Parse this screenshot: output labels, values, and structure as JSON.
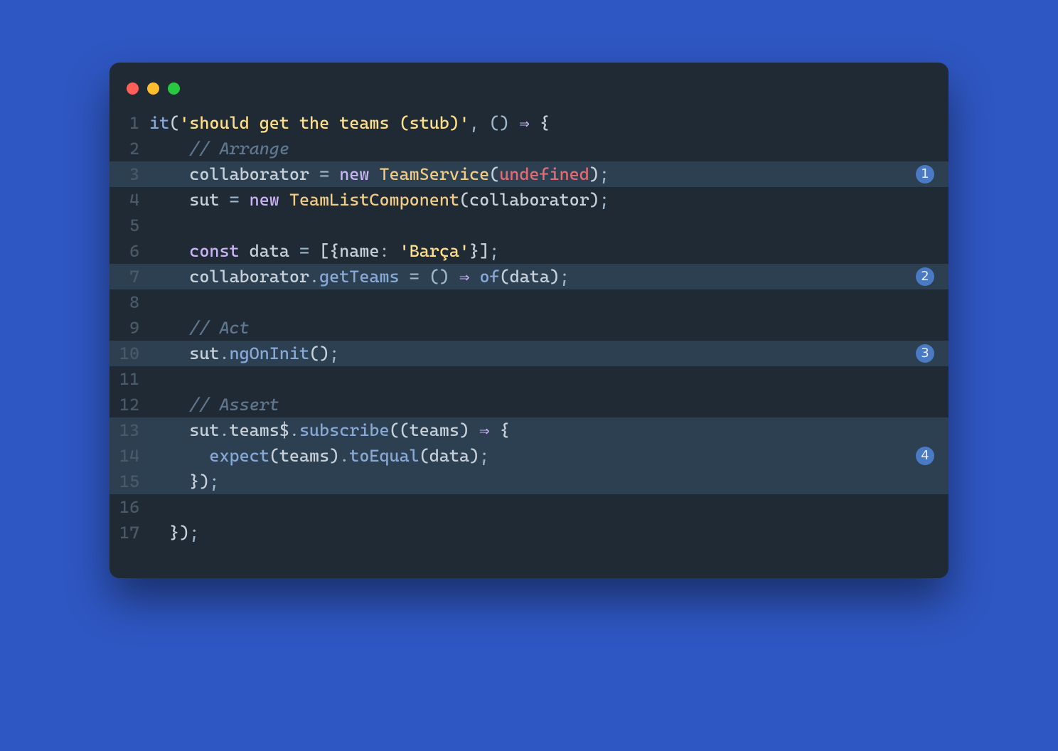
{
  "window": {
    "traffic_light": {
      "close": "close",
      "minimize": "minimize",
      "zoom": "zoom"
    }
  },
  "code": {
    "lines": [
      {
        "n": "1",
        "highlight": false,
        "badge": null,
        "tokens": [
          {
            "t": "it",
            "c": "tok-fn"
          },
          {
            "t": "(",
            "c": "tok-par"
          },
          {
            "t": "'should get the teams (stub)'",
            "c": "tok-str"
          },
          {
            "t": ", () ",
            "c": "tok-op"
          },
          {
            "t": "⇒",
            "c": "tok-arrow"
          },
          {
            "t": " {",
            "c": "tok-par"
          }
        ]
      },
      {
        "n": "2",
        "highlight": false,
        "badge": null,
        "tokens": [
          {
            "t": "    ",
            "c": "tok-op"
          },
          {
            "t": "// Arrange",
            "c": "tok-cmt"
          }
        ]
      },
      {
        "n": "3",
        "highlight": true,
        "badge": "1",
        "tokens": [
          {
            "t": "    ",
            "c": "tok-op"
          },
          {
            "t": "collaborator",
            "c": "tok-var"
          },
          {
            "t": " = ",
            "c": "tok-op"
          },
          {
            "t": "new ",
            "c": "tok-kw"
          },
          {
            "t": "TeamService",
            "c": "tok-type"
          },
          {
            "t": "(",
            "c": "tok-par"
          },
          {
            "t": "undefined",
            "c": "tok-const"
          },
          {
            "t": ")",
            "c": "tok-par"
          },
          {
            "t": ";",
            "c": "tok-op"
          }
        ]
      },
      {
        "n": "4",
        "highlight": false,
        "badge": null,
        "tokens": [
          {
            "t": "    ",
            "c": "tok-op"
          },
          {
            "t": "sut",
            "c": "tok-var"
          },
          {
            "t": " = ",
            "c": "tok-op"
          },
          {
            "t": "new ",
            "c": "tok-kw"
          },
          {
            "t": "TeamListComponent",
            "c": "tok-type"
          },
          {
            "t": "(",
            "c": "tok-par"
          },
          {
            "t": "collaborator",
            "c": "tok-var"
          },
          {
            "t": ")",
            "c": "tok-par"
          },
          {
            "t": ";",
            "c": "tok-op"
          }
        ]
      },
      {
        "n": "5",
        "highlight": false,
        "badge": null,
        "tokens": []
      },
      {
        "n": "6",
        "highlight": false,
        "badge": null,
        "tokens": [
          {
            "t": "    ",
            "c": "tok-op"
          },
          {
            "t": "const ",
            "c": "tok-kw"
          },
          {
            "t": "data",
            "c": "tok-var"
          },
          {
            "t": " = ",
            "c": "tok-op"
          },
          {
            "t": "[{",
            "c": "tok-par"
          },
          {
            "t": "name",
            "c": "tok-var"
          },
          {
            "t": ": ",
            "c": "tok-op"
          },
          {
            "t": "'Barça'",
            "c": "tok-str"
          },
          {
            "t": "}]",
            "c": "tok-par"
          },
          {
            "t": ";",
            "c": "tok-op"
          }
        ]
      },
      {
        "n": "7",
        "highlight": true,
        "badge": "2",
        "tokens": [
          {
            "t": "    ",
            "c": "tok-op"
          },
          {
            "t": "collaborator",
            "c": "tok-var"
          },
          {
            "t": ".",
            "c": "tok-op"
          },
          {
            "t": "getTeams",
            "c": "tok-fn"
          },
          {
            "t": " = () ",
            "c": "tok-op"
          },
          {
            "t": "⇒",
            "c": "tok-arrow"
          },
          {
            "t": " ",
            "c": "tok-op"
          },
          {
            "t": "of",
            "c": "tok-fn"
          },
          {
            "t": "(",
            "c": "tok-par"
          },
          {
            "t": "data",
            "c": "tok-var"
          },
          {
            "t": ")",
            "c": "tok-par"
          },
          {
            "t": ";",
            "c": "tok-op"
          }
        ]
      },
      {
        "n": "8",
        "highlight": false,
        "badge": null,
        "tokens": []
      },
      {
        "n": "9",
        "highlight": false,
        "badge": null,
        "tokens": [
          {
            "t": "    ",
            "c": "tok-op"
          },
          {
            "t": "// Act",
            "c": "tok-cmt"
          }
        ]
      },
      {
        "n": "10",
        "highlight": true,
        "badge": "3",
        "tokens": [
          {
            "t": "    ",
            "c": "tok-op"
          },
          {
            "t": "sut",
            "c": "tok-var"
          },
          {
            "t": ".",
            "c": "tok-op"
          },
          {
            "t": "ngOnInit",
            "c": "tok-fn"
          },
          {
            "t": "()",
            "c": "tok-par"
          },
          {
            "t": ";",
            "c": "tok-op"
          }
        ]
      },
      {
        "n": "11",
        "highlight": false,
        "badge": null,
        "tokens": []
      },
      {
        "n": "12",
        "highlight": false,
        "badge": null,
        "tokens": [
          {
            "t": "    ",
            "c": "tok-op"
          },
          {
            "t": "// Assert",
            "c": "tok-cmt"
          }
        ]
      },
      {
        "n": "13",
        "highlight": true,
        "badge": null,
        "tokens": [
          {
            "t": "    ",
            "c": "tok-op"
          },
          {
            "t": "sut",
            "c": "tok-var"
          },
          {
            "t": ".",
            "c": "tok-op"
          },
          {
            "t": "teams$",
            "c": "tok-var"
          },
          {
            "t": ".",
            "c": "tok-op"
          },
          {
            "t": "subscribe",
            "c": "tok-fn"
          },
          {
            "t": "((",
            "c": "tok-par"
          },
          {
            "t": "teams",
            "c": "tok-var"
          },
          {
            "t": ") ",
            "c": "tok-par"
          },
          {
            "t": "⇒",
            "c": "tok-arrow"
          },
          {
            "t": " {",
            "c": "tok-par"
          }
        ]
      },
      {
        "n": "14",
        "highlight": true,
        "badge": "4",
        "tokens": [
          {
            "t": "      ",
            "c": "tok-op"
          },
          {
            "t": "expect",
            "c": "tok-fn"
          },
          {
            "t": "(",
            "c": "tok-par"
          },
          {
            "t": "teams",
            "c": "tok-var"
          },
          {
            "t": ")",
            "c": "tok-par"
          },
          {
            "t": ".",
            "c": "tok-op"
          },
          {
            "t": "toEqual",
            "c": "tok-fn"
          },
          {
            "t": "(",
            "c": "tok-par"
          },
          {
            "t": "data",
            "c": "tok-var"
          },
          {
            "t": ")",
            "c": "tok-par"
          },
          {
            "t": ";",
            "c": "tok-op"
          }
        ]
      },
      {
        "n": "15",
        "highlight": true,
        "badge": null,
        "tokens": [
          {
            "t": "    ",
            "c": "tok-op"
          },
          {
            "t": "})",
            "c": "tok-par"
          },
          {
            "t": ";",
            "c": "tok-op"
          }
        ]
      },
      {
        "n": "16",
        "highlight": false,
        "badge": null,
        "tokens": []
      },
      {
        "n": "17",
        "highlight": false,
        "badge": null,
        "tokens": [
          {
            "t": "  ",
            "c": "tok-op"
          },
          {
            "t": "})",
            "c": "tok-par"
          },
          {
            "t": ";",
            "c": "tok-op"
          }
        ]
      }
    ]
  }
}
